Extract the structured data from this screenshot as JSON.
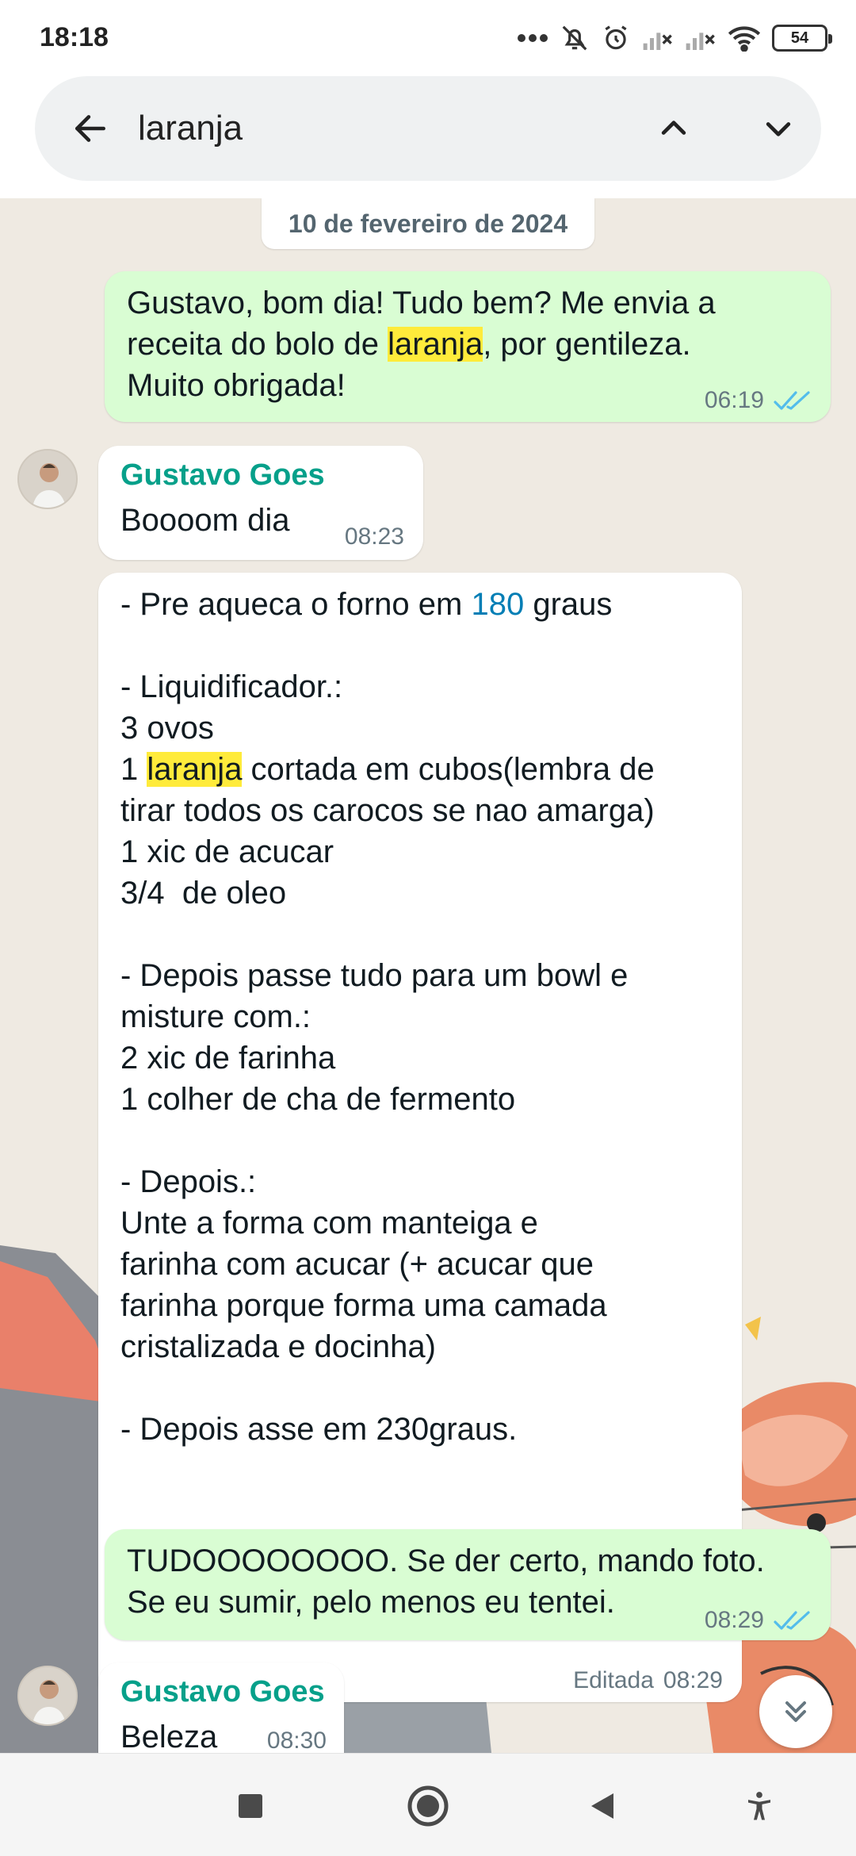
{
  "status_bar": {
    "time": "18:18",
    "battery": "54",
    "icons": [
      "more-dots-icon",
      "notifications-off-icon",
      "alarm-icon",
      "signal-no-service-icon",
      "signal-no-service-icon",
      "wifi-icon",
      "battery-icon"
    ]
  },
  "search": {
    "query": "laranja",
    "back_icon": "arrow-left-icon",
    "prev_icon": "chevron-up-icon",
    "next_icon": "chevron-down-icon"
  },
  "date_chip": "10 de fevereiro de 2024",
  "messages": [
    {
      "direction": "outgoing",
      "text_before": "Gustavo, bom dia! Tudo bem? Me envia a\nreceita do bolo de ",
      "highlight": "laranja",
      "text_after": ", por gentileza.\nMuito obrigada!",
      "time": "06:19",
      "status": "read"
    },
    {
      "direction": "incoming",
      "sender": "Gustavo Goes",
      "text": "Boooom dia",
      "time": "08:23"
    },
    {
      "direction": "incoming",
      "line1_before": "- Pre aqueca o forno em ",
      "line1_number": "180",
      "line1_after": " graus",
      "block2_before": "\n\n- Liquidificador.:\n3 ovos\n1 ",
      "highlight": "laranja",
      "block2_after": " cortada em cubos(lembra de\ntirar todos os carocos se nao amarga)\n1 xic de acucar\n3/4  de oleo\n\n- Depois passe tudo para um bowl e\nmisture com.:\n2 xic de farinha\n1 colher de cha de fermento\n\n- Depois.:\nUnte a forma com manteiga e\nfarinha com acucar (+ acucar que\nfarinha porque forma uma camada\ncristalizada e docinha)\n\n- Depois asse em 230graus.",
      "edited_label": "Editada",
      "time": "08:29"
    },
    {
      "direction": "outgoing",
      "text": "TUDOOOOOOOO. Se der certo, mando foto.\nSe eu sumir, pelo menos eu tentei.",
      "time": "08:29",
      "status": "read"
    },
    {
      "direction": "incoming",
      "sender": "Gustavo Goes",
      "text": "Beleza",
      "time": "08:30"
    }
  ],
  "scroll_button_icon": "double-chevron-down-icon",
  "nav_bar": {
    "icons": [
      "square-icon",
      "home-circle-icon",
      "back-triangle-icon",
      "accessibility-icon"
    ]
  },
  "colors": {
    "outgoing_bubble": "#d9fdd3",
    "incoming_bubble": "#ffffff",
    "sender_name": "#06a08a",
    "read_ticks": "#53bdeb",
    "search_highlight": "#ffeb3b",
    "link_number": "#027eb5"
  }
}
